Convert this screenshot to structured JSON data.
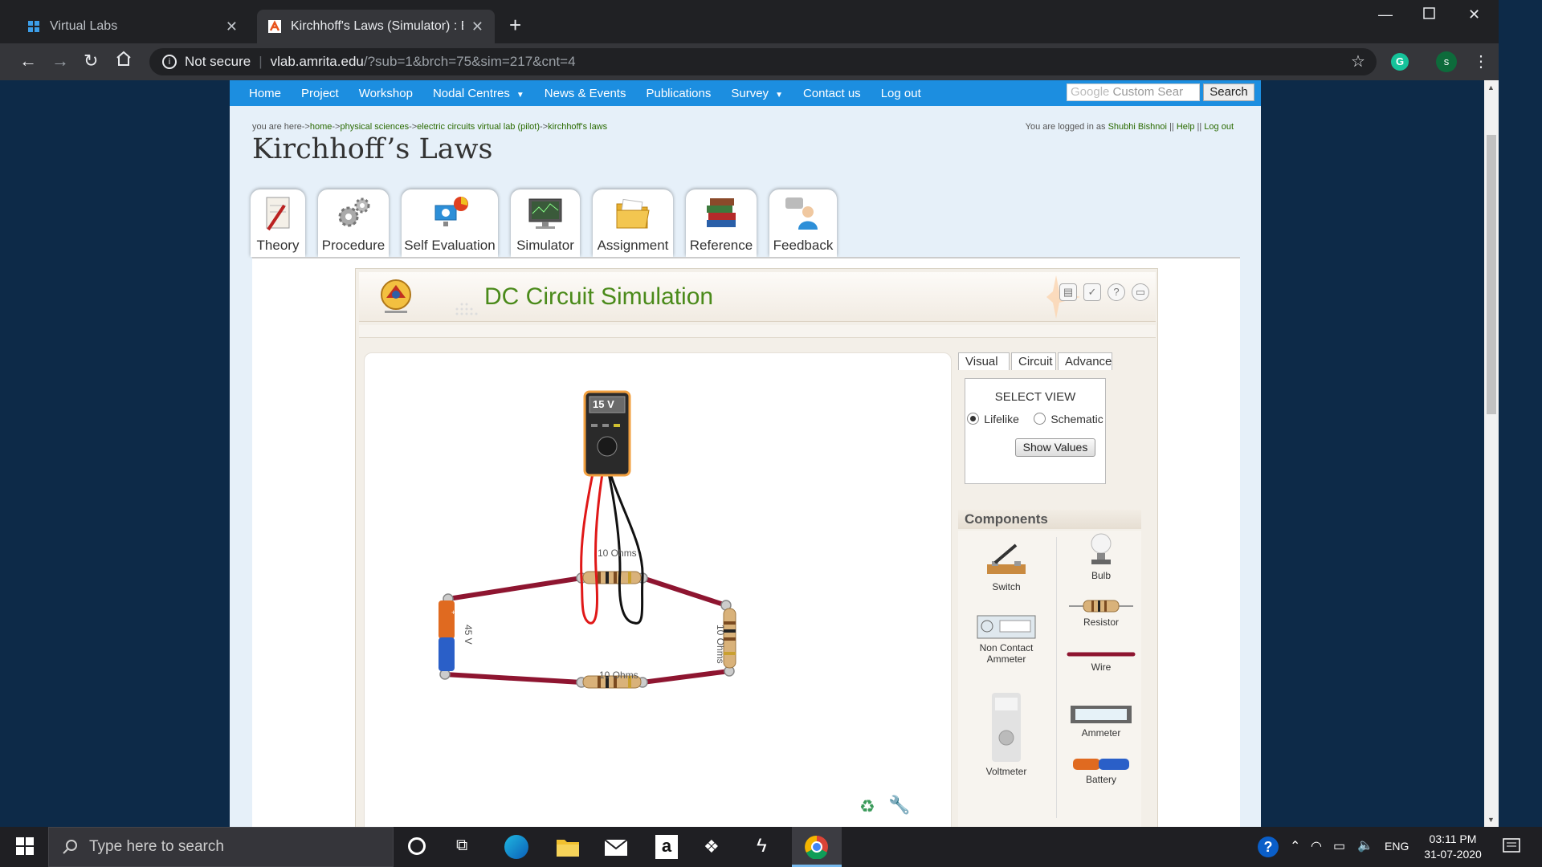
{
  "browser": {
    "tabs": [
      {
        "title": "Virtual Labs",
        "close": "✕"
      },
      {
        "title": "Kirchhoff's Laws (Simulator) : Elec",
        "close": "✕"
      }
    ],
    "new_tab": "+",
    "address": {
      "security": "Not secure",
      "host": "vlab.amrita.edu",
      "path": "/?sub=1&brch=75&sim=217&cnt=4"
    },
    "profile_initial": "s",
    "extension_initial": "G"
  },
  "site": {
    "nav": [
      "Home",
      "Project",
      "Workshop",
      "Nodal Centres",
      "News & Events",
      "Publications",
      "Survey",
      "Contact us",
      "Log out"
    ],
    "search_placeholder": "Custom Sear",
    "search_brand": "Google",
    "search_button": "Search",
    "breadcrumb": {
      "prefix": "you are here->",
      "items": [
        "home",
        "physical sciences",
        "electric circuits virtual lab (pilot)",
        "kirchhoff's laws"
      ],
      "sep": "->"
    },
    "login": {
      "prefix": "You are logged in as",
      "user": "Shubhi Bishnoi",
      "help": "Help",
      "logout": "Log out",
      "sep": "||"
    },
    "title": "Kirchhoff’s Laws",
    "tabs": [
      "Theory",
      "Procedure",
      "Self Evaluation",
      "Simulator",
      "Assignment",
      "Reference",
      "Feedback"
    ]
  },
  "simulator": {
    "title": "DC Circuit Simulation",
    "meter_reading": "15 V",
    "labels": {
      "r_top": "10 Ohms",
      "r_right": "10 Ohms",
      "r_bottom": "10 Ohms",
      "battery": "45 V"
    },
    "side_tabs": [
      "Visual",
      "Circuit",
      "Advanced"
    ],
    "select_view": "SELECT VIEW",
    "view_options": [
      "Lifelike",
      "Schematic"
    ],
    "selected_view": "Lifelike",
    "show_values": "Show Values",
    "components_title": "Components",
    "components": [
      "Switch",
      "Bulb",
      "Resistor",
      "Non Contact Ammeter",
      "Wire",
      "Ammeter",
      "Voltmeter",
      "Battery"
    ]
  },
  "taskbar": {
    "search_placeholder": "Type here to search",
    "lang": "ENG",
    "time": "03:11 PM",
    "date": "31-07-2020"
  },
  "colors": {
    "nav_blue": "#1c8ee0",
    "sim_title_green": "#4a8a1a",
    "wire": "#8e1530"
  }
}
